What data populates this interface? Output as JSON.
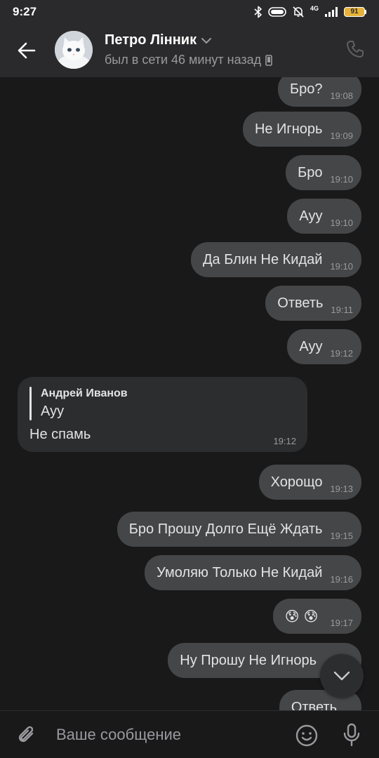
{
  "status_bar": {
    "time": "9:27",
    "network": "4G",
    "battery": "91"
  },
  "header": {
    "contact_name": "Петро Лінник",
    "last_seen": "был в сети 46 минут назад"
  },
  "messages": [
    {
      "text": "Бро?",
      "time": "19:08"
    },
    {
      "text": "Не Игнорь",
      "time": "19:09"
    },
    {
      "text": "Бро",
      "time": "19:10"
    },
    {
      "text": "Ауу",
      "time": "19:10"
    },
    {
      "text": "Да Блин Не Кидай",
      "time": "19:10"
    },
    {
      "text": "Ответь",
      "time": "19:11"
    },
    {
      "text": "Ауу",
      "time": "19:12"
    },
    {
      "text": "Хорощо",
      "time": "19:13"
    },
    {
      "text": "Бро Прошу Долго Ещё Ждать",
      "time": "19:15"
    },
    {
      "text": "Умоляю Только Не Кидай",
      "time": "19:16"
    },
    {
      "text": "😰😰",
      "time": "19:17"
    },
    {
      "text": "Ну Прошу Не Игнорь",
      "time": ""
    },
    {
      "text": "Ответь",
      "time": ""
    }
  ],
  "incoming": {
    "reply_author": "Андрей Иванов",
    "reply_text": "Ауу",
    "text": "Не спамь",
    "time": "19:12"
  },
  "composer": {
    "placeholder": "Ваше сообщение"
  },
  "icons": {
    "back": "arrow-left-icon",
    "call": "phone-icon",
    "attach": "paperclip-icon",
    "emoji": "smile-icon",
    "mic": "microphone-icon",
    "scroll": "chevron-down-icon"
  },
  "colors": {
    "background": "#19191a",
    "header": "#2a2a2c",
    "outgoing_bubble": "#454647",
    "incoming_bubble": "#2c2d2f",
    "battery": "#e6b23a"
  }
}
